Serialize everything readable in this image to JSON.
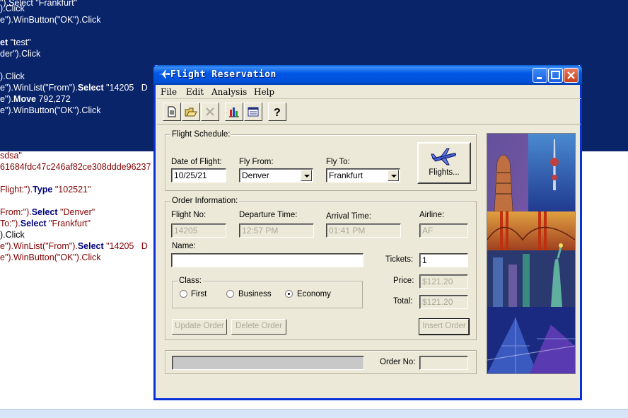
{
  "editor": {
    "lines": [
      {
        "segments": [
          {
            "text": "\").Select \"Frankfurt\"",
            "kw": false
          }
        ],
        "selected": true
      },
      {
        "segments": [
          {
            "text": ").Click",
            "kw": false
          }
        ],
        "selected": true
      },
      {
        "segments": [
          {
            "text": "e\").WinButton(\"OK\").Click",
            "kw": false
          }
        ],
        "selected": true
      },
      {
        "segments": [
          {
            "text": "",
            "kw": false
          }
        ],
        "selected": true
      },
      {
        "segments": [
          {
            "text": "et",
            "kw": true
          },
          {
            "text": " \"test\"",
            "kw": false
          }
        ],
        "selected": true
      },
      {
        "segments": [
          {
            "text": "der\").Click",
            "kw": false
          }
        ],
        "selected": true
      },
      {
        "segments": [
          {
            "text": "",
            "kw": false
          }
        ],
        "selected": true
      },
      {
        "segments": [
          {
            "text": ").Click",
            "kw": false
          }
        ],
        "selected": true
      },
      {
        "segments": [
          {
            "text": "e\").WinList(\"From\").",
            "kw": false
          },
          {
            "text": "Select",
            "kw": true
          },
          {
            "text": " \"14205   D",
            "kw": false
          }
        ],
        "selected": true
      },
      {
        "segments": [
          {
            "text": "e\").",
            "kw": false
          },
          {
            "text": "Move",
            "kw": true
          },
          {
            "text": " 792,272",
            "kw": false
          }
        ],
        "selected": true
      },
      {
        "segments": [
          {
            "text": "e\").WinButton(\"OK\").Click",
            "kw": false
          }
        ],
        "selected": true
      },
      {
        "segments": [
          {
            "text": "sdsa\"",
            "kw": false,
            "str": true
          }
        ],
        "selected": false
      },
      {
        "segments": [
          {
            "text": "61684fdc47c246af82ce308ddde96237",
            "kw": false,
            "str": true
          }
        ],
        "selected": false
      },
      {
        "segments": [
          {
            "text": "",
            "kw": false
          }
        ],
        "selected": false
      },
      {
        "segments": [
          {
            "text": "Flight:\").",
            "kw": false,
            "str": true
          },
          {
            "text": "Type",
            "kw": true
          },
          {
            "text": " \"102521\"",
            "kw": false,
            "str": true
          }
        ],
        "selected": false
      },
      {
        "segments": [
          {
            "text": "",
            "kw": false
          }
        ],
        "selected": false
      },
      {
        "segments": [
          {
            "text": "From:\").",
            "kw": false,
            "str": true
          },
          {
            "text": "Select",
            "kw": true
          },
          {
            "text": " \"Denver\"",
            "kw": false,
            "str": true
          }
        ],
        "selected": false
      },
      {
        "segments": [
          {
            "text": "To:\").",
            "kw": false,
            "str": true
          },
          {
            "text": "Select",
            "kw": true
          },
          {
            "text": " \"Frankfurt\"",
            "kw": false,
            "str": true
          }
        ],
        "selected": false
      },
      {
        "segments": [
          {
            "text": ").Click",
            "kw": false
          }
        ],
        "selected": false
      },
      {
        "segments": [
          {
            "text": "e\").WinList(\"From\").",
            "kw": false,
            "str": true
          },
          {
            "text": "Select",
            "kw": true
          },
          {
            "text": " \"14205   D",
            "kw": false,
            "str": true
          }
        ],
        "selected": false
      },
      {
        "segments": [
          {
            "text": "e\").WinButton(\"OK\").Click",
            "kw": false,
            "str": true
          }
        ],
        "selected": false
      }
    ]
  },
  "window": {
    "title": "Flight Reservation",
    "menu": [
      "File",
      "Edit",
      "Analysis",
      "Help"
    ],
    "toolbar_icons": [
      "new-order-icon",
      "open-order-icon",
      "delete-order-icon",
      "graph-icon",
      "fax-order-icon",
      "help-icon"
    ]
  },
  "schedule": {
    "group_label": "Flight Schedule:",
    "date_label": "Date of Flight:",
    "date_value": "10/25/21",
    "from_label": "Fly From:",
    "from_value": "Denver",
    "to_label": "Fly To:",
    "to_value": "Frankfurt",
    "flights_button": "Flights..."
  },
  "order": {
    "group_label": "Order Information:",
    "flight_no_label": "Flight No:",
    "flight_no_value": "14205",
    "departure_label": "Departure Time:",
    "departure_value": "12:57 PM",
    "arrival_label": "Arrival Time:",
    "arrival_value": "01:41 PM",
    "airline_label": "Airline:",
    "airline_value": "AF",
    "name_label": "Name:",
    "name_value": "",
    "tickets_label": "Tickets:",
    "tickets_value": "1",
    "price_label": "Price:",
    "price_value": "$121.20",
    "total_label": "Total:",
    "total_value": "$121.20",
    "class_label": "Class:",
    "class_options": [
      "First",
      "Business",
      "Economy"
    ],
    "class_selected": "Economy",
    "update_button": "Update Order",
    "delete_button": "Delete Order",
    "insert_button": "Insert Order"
  },
  "footer": {
    "order_no_label": "Order No:",
    "order_no_value": ""
  },
  "colors": {
    "selection": "#0a246a",
    "titlebar": "#0058e6",
    "window_face": "#ece9d8",
    "keyword": "#000080",
    "string": "#800000"
  }
}
